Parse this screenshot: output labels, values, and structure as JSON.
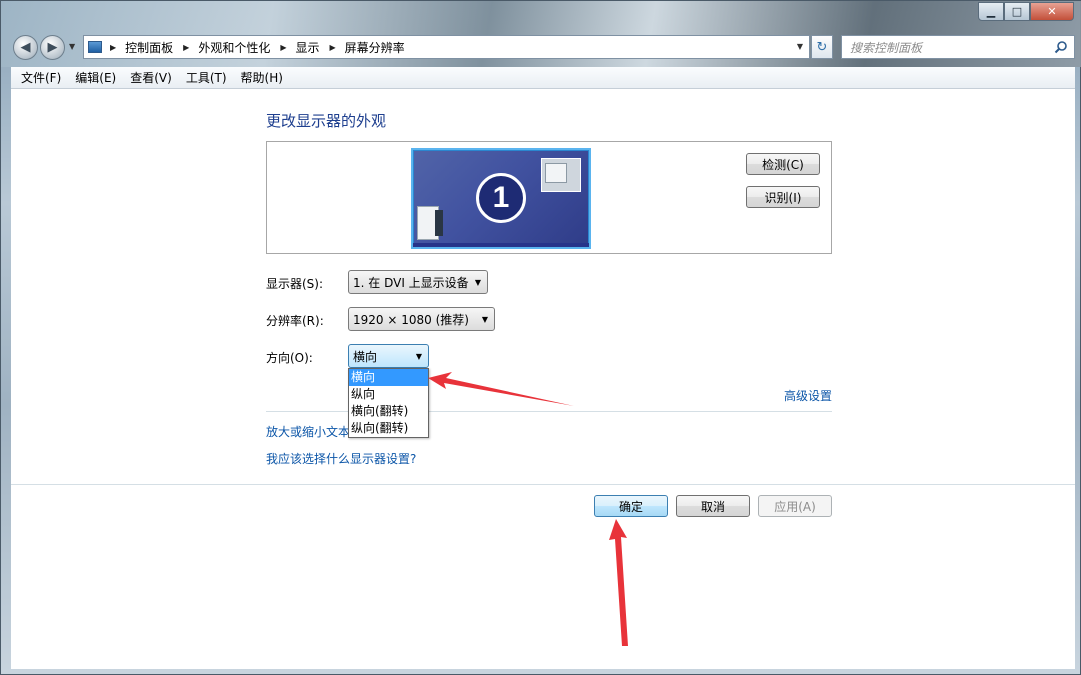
{
  "window": {
    "minimize": "▭",
    "maximize": "□",
    "close": "✕"
  },
  "nav": {
    "breadcrumbs": [
      "控制面板",
      "外观和个性化",
      "显示",
      "屏幕分辨率"
    ],
    "search_placeholder": "搜索控制面板"
  },
  "menu": [
    "文件(F)",
    "编辑(E)",
    "查看(V)",
    "工具(T)",
    "帮助(H)"
  ],
  "main": {
    "title": "更改显示器的外观",
    "monitor_number": "1",
    "detect_label": "检测(C)",
    "identify_label": "识别(I)",
    "display_label": "显示器(S):",
    "display_value": "1. 在 DVI 上显示设备",
    "resolution_label": "分辨率(R):",
    "resolution_value": "1920 × 1080 (推荐)",
    "orientation_label": "方向(O):",
    "orientation_value": "横向",
    "orientation_options": [
      "横向",
      "纵向",
      "横向(翻转)",
      "纵向(翻转)"
    ],
    "orientation_selected_index": 0,
    "advanced_link": "高级设置",
    "text_size_link": "放大或缩小文本",
    "help_link": "我应该选择什么显示器设置?"
  },
  "footer": {
    "ok_label": "确定",
    "cancel_label": "取消",
    "apply_label": "应用(A)"
  },
  "colors": {
    "link": "#0c56a8",
    "title": "#1e3f8f",
    "selection": "#3399ff",
    "annotation_arrow": "#e8333a"
  }
}
